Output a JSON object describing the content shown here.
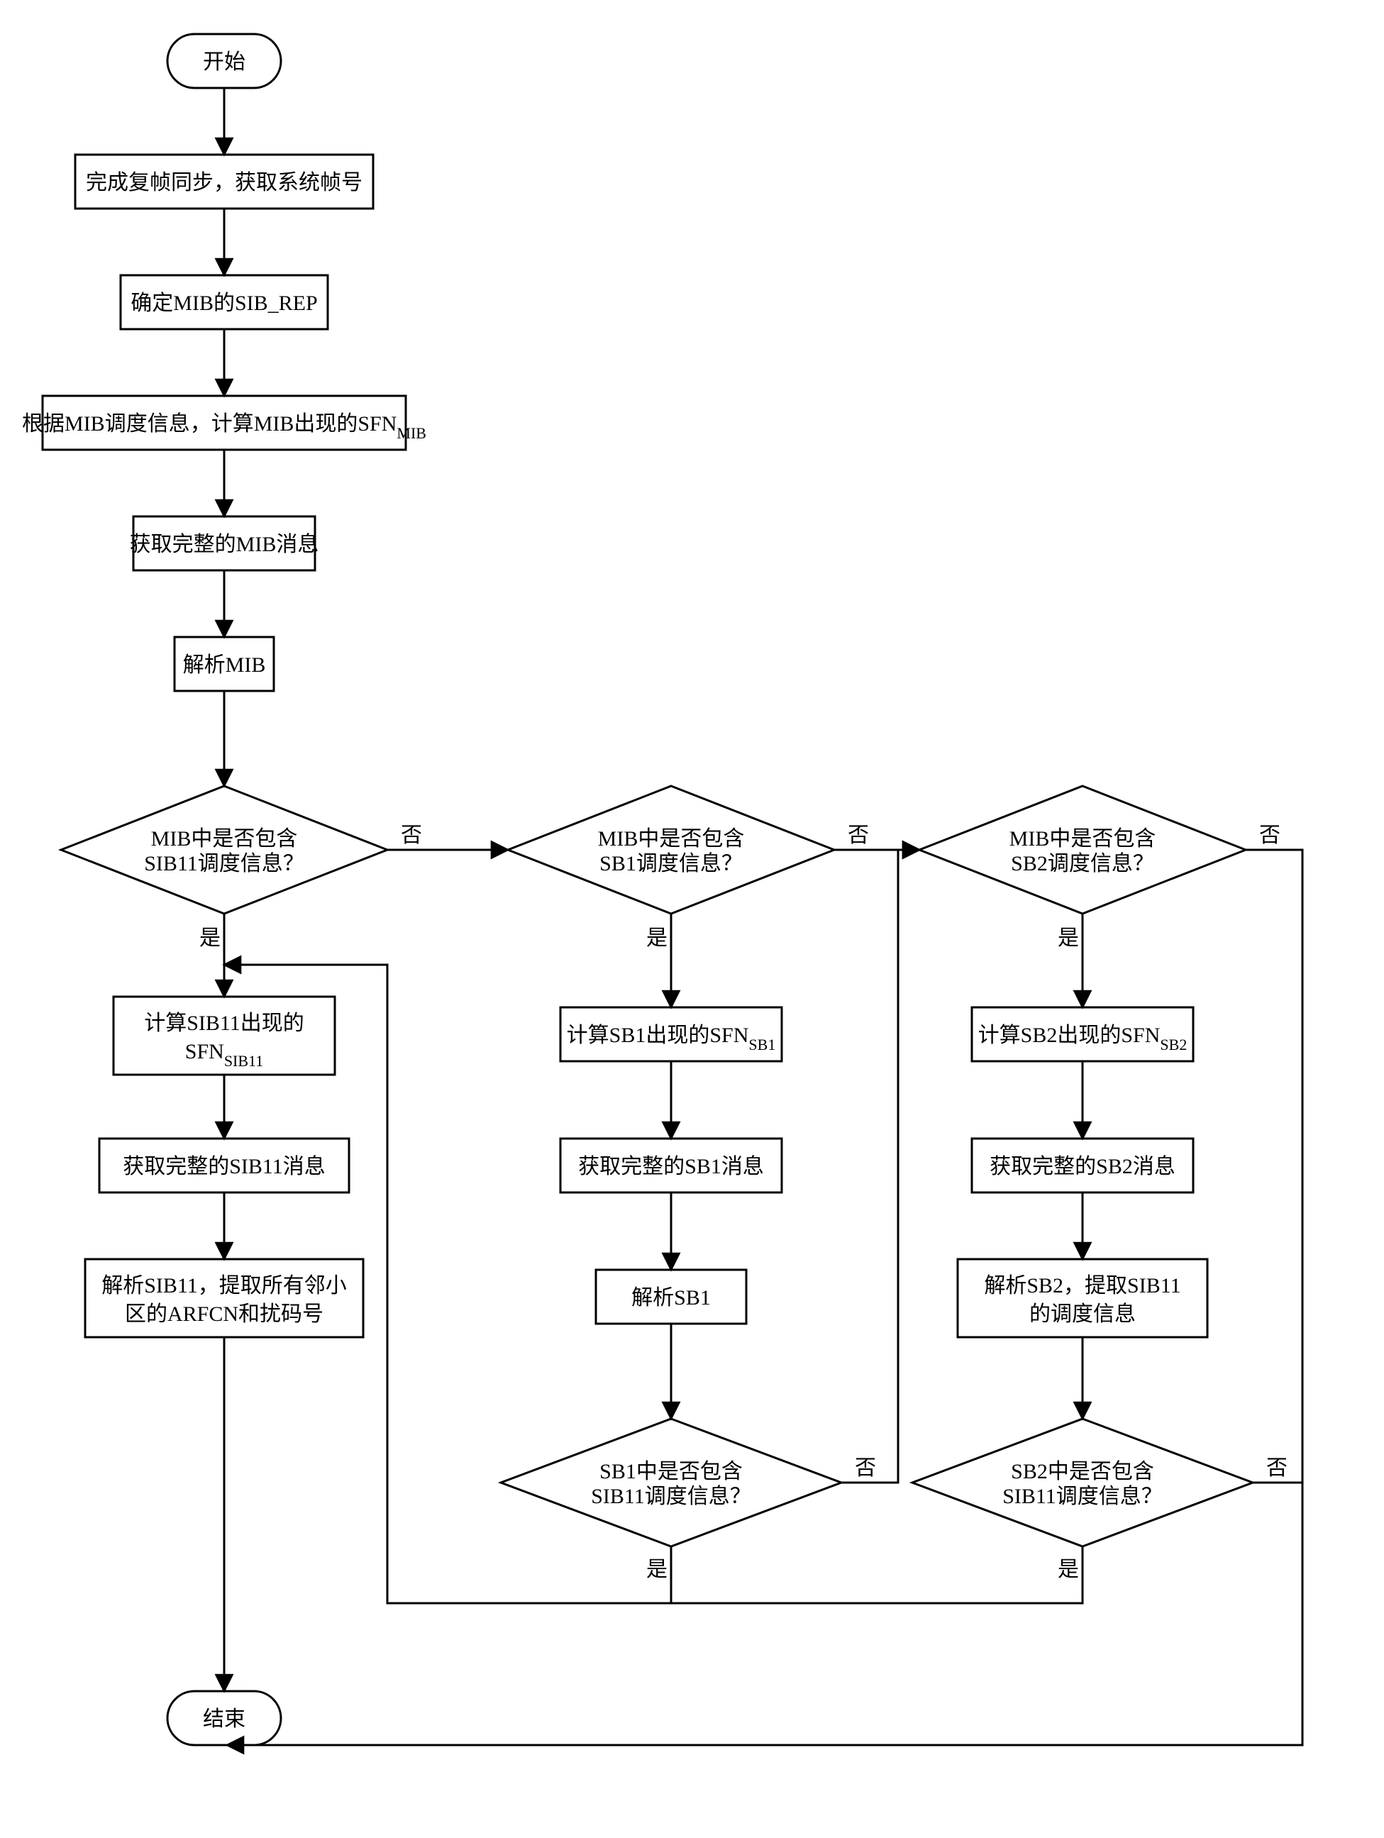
{
  "terminals": {
    "start": "开始",
    "end": "结束"
  },
  "steps": {
    "s1": "完成复帧同步，获取系统帧号",
    "s2": "确定MIB的SIB_REP",
    "s3_a": "根据MIB调度信息，计算MIB出现的SFN",
    "s3_sub": "MIB",
    "s4": "获取完整的MIB消息",
    "s5": "解析MIB",
    "d1_l1": "MIB中是否包含",
    "d1_l2": "SIB11调度信息？",
    "d2_l1": "MIB中是否包含",
    "d2_l2": "SB1调度信息？",
    "d3_l1": "MIB中是否包含",
    "d3_l2": "SB2调度信息？",
    "c1_s1_a": "计算SIB11出现的",
    "c1_s1_b": "SFN",
    "c1_s1_sub": "SIB11",
    "c1_s2": "获取完整的SIB11消息",
    "c1_s3_l1": "解析SIB11，提取所有邻小",
    "c1_s3_l2": "区的ARFCN和扰码号",
    "c2_s1_a": "计算SB1出现的SFN",
    "c2_s1_sub": "SB1",
    "c2_s2": "获取完整的SB1消息",
    "c2_s3": "解析SB1",
    "c2_d_l1": "SB1中是否包含",
    "c2_d_l2": "SIB11调度信息？",
    "c3_s1_a": "计算SB2出现的SFN",
    "c3_s1_sub": "SB2",
    "c3_s2": "获取完整的SB2消息",
    "c3_s3_l1": "解析SB2，提取SIB11",
    "c3_s3_l2": "的调度信息",
    "c3_d_l1": "SB2中是否包含",
    "c3_d_l2": "SIB11调度信息？"
  },
  "labels": {
    "yes": "是",
    "no": "否"
  }
}
